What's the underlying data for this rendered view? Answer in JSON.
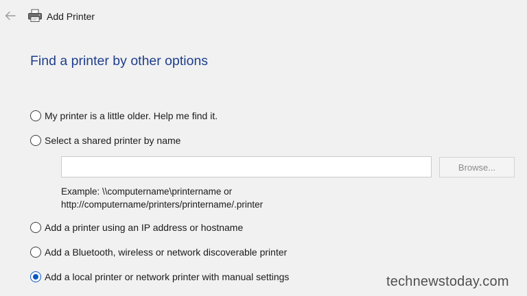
{
  "window": {
    "title": "Add Printer"
  },
  "heading": "Find a printer by other options",
  "options": [
    {
      "label": "My printer is a little older. Help me find it.",
      "checked": false
    },
    {
      "label": "Select a shared printer by name",
      "checked": false
    },
    {
      "label": "Add a printer using an IP address or hostname",
      "checked": false
    },
    {
      "label": "Add a Bluetooth, wireless or network discoverable printer",
      "checked": false
    },
    {
      "label": "Add a local printer or network printer with manual settings",
      "checked": true
    }
  ],
  "shared_printer": {
    "input_value": "",
    "browse_label": "Browse...",
    "example_line1": "Example: \\\\computername\\printername or",
    "example_line2": "http://computername/printers/printername/.printer"
  },
  "watermark": "technewstoday.com",
  "colors": {
    "heading": "#1e3e8c",
    "accent": "#0b58c4",
    "background": "#f1f1f1"
  },
  "icons": {
    "back": "back-arrow-icon",
    "printer": "printer-icon"
  }
}
